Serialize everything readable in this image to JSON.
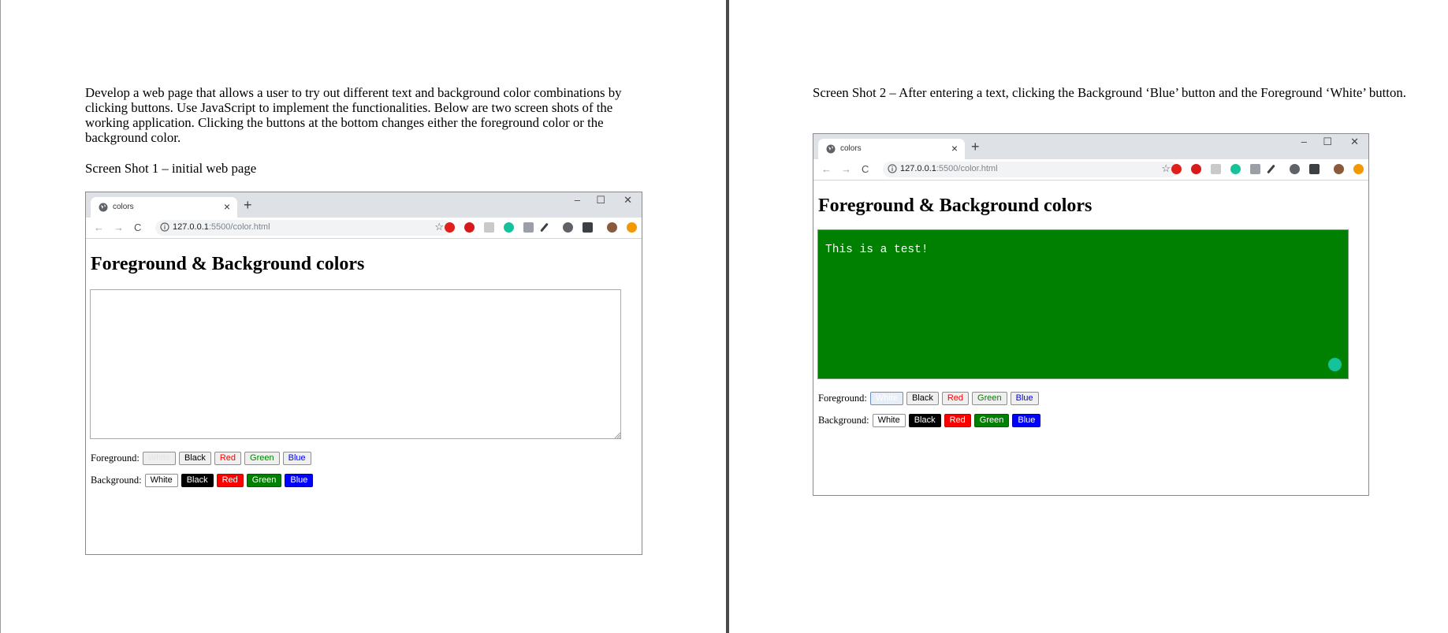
{
  "left_page": {
    "intro": "Develop a web page that allows a user to try out different text and background color combinations by clicking buttons. Use JavaScript to implement the functionalities. Below are two screen shots of the working application. Clicking the buttons at the bottom changes either the foreground color or the background color.",
    "caption": "Screen Shot 1 – initial web page"
  },
  "right_page": {
    "caption": "Screen Shot 2 – After entering a text, clicking the Background ‘Blue’ button and the Foreground ‘White’ button."
  },
  "browser": {
    "tab_title": "colors",
    "new_tab_symbol": "+",
    "tab_close_symbol": "×",
    "minimize_symbol": "–",
    "maximize_symbol": "☐",
    "close_symbol": "✕",
    "back_symbol": "←",
    "forward_symbol": "→",
    "reload_symbol": "C",
    "star_symbol": "☆",
    "url_host": "127.0.0.1",
    "url_path": ":5500/color.html"
  },
  "app": {
    "heading": "Foreground & Background colors",
    "foreground_label": "Foreground:",
    "background_label": "Background:",
    "buttons": [
      "White",
      "Black",
      "Red",
      "Green",
      "Blue"
    ]
  },
  "screenshot1": {
    "textarea_text": "",
    "textarea_bg": "#ffffff",
    "textarea_fg": "#000000"
  },
  "screenshot2": {
    "textarea_text": "This is a test!",
    "textarea_bg": "#008000",
    "textarea_fg": "#ffffff"
  },
  "colors": {
    "white": "#ffffff",
    "black": "#000000",
    "red": "#ff0000",
    "green": "#008000",
    "blue": "#0000ff",
    "tabbar": "#dee1e6",
    "gutter": "#4a4a4a",
    "grammarly": "#15c39a"
  },
  "icons": {
    "extensions": [
      "opera-icon",
      "adblock-icon",
      "document-icon",
      "grammarly-icon",
      "eyedropper-icon",
      "pen-icon",
      "contrast-icon",
      "cube-icon",
      "avatar-icon",
      "alert-icon"
    ],
    "ext_colors": [
      "#e0201a",
      "#d91a1a",
      "#c9c9c9",
      "#15c39a",
      "#9aa0a6",
      "#3c4043",
      "#5f6368",
      "#3c4043",
      "#8a5a3c",
      "#f29900"
    ]
  }
}
